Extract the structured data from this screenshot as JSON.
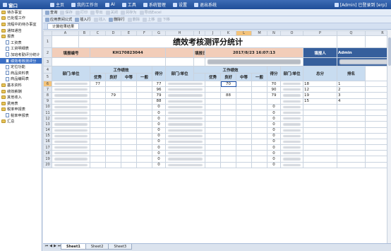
{
  "app": {
    "title": "窗口",
    "menu": [
      {
        "label": "主页"
      },
      {
        "label": "我的工作台"
      },
      {
        "label": "AI"
      },
      {
        "label": "工具"
      },
      {
        "label": "系统管理"
      },
      {
        "label": "设置"
      },
      {
        "label": "退出系统"
      }
    ],
    "user": "[Admin] 已登录到 [erp]"
  },
  "sidebar": {
    "items": [
      {
        "label": "待办事宜",
        "level": 1,
        "icon": "folder-icon"
      },
      {
        "label": "已处理工作",
        "level": 1,
        "icon": "folder-icon"
      },
      {
        "label": "流程中的待办事宜",
        "level": 1,
        "icon": "folder-icon"
      },
      {
        "label": "通知通告",
        "level": 1,
        "icon": "folder-icon"
      },
      {
        "label": "报表",
        "level": 1,
        "icon": "folder-icon"
      },
      {
        "label": "工资表",
        "level": 2,
        "icon": "doc-icon"
      },
      {
        "label": "工资明细表",
        "level": 2,
        "icon": "doc-icon"
      },
      {
        "label": "加班考勤评分统计",
        "level": 2,
        "icon": "doc-icon"
      },
      {
        "label": "绩效考核测评分",
        "level": 2,
        "icon": "doc-icon",
        "selected": true
      },
      {
        "label": "定位功能",
        "level": 2,
        "icon": "doc-icon"
      },
      {
        "label": "商品资料表",
        "level": 2,
        "icon": "doc-icon"
      },
      {
        "label": "商品编码表",
        "level": 2,
        "icon": "doc-icon"
      },
      {
        "label": "基本资料",
        "level": 1,
        "icon": "folder-icon"
      },
      {
        "label": "绩效薪酬",
        "level": 1,
        "icon": "folder-icon"
      },
      {
        "label": "其他收入",
        "level": 1,
        "icon": "folder-icon"
      },
      {
        "label": "费用表",
        "level": 1,
        "icon": "folder-icon"
      },
      {
        "label": "税率申报表",
        "level": 1,
        "icon": "folder-icon"
      },
      {
        "label": "税率申报表",
        "level": 2,
        "icon": "doc-icon"
      },
      {
        "label": "汇总",
        "level": 1,
        "icon": "folder-icon"
      }
    ]
  },
  "toolbar1": {
    "buttons": [
      {
        "label": "查询",
        "enabled": true
      },
      {
        "label": "保存",
        "enabled": false
      },
      {
        "label": "打印",
        "enabled": false
      },
      {
        "label": "导出",
        "enabled": false
      },
      {
        "label": "关闭",
        "enabled": false
      },
      {
        "label": "另存为",
        "enabled": false
      },
      {
        "label": "导出Excel",
        "enabled": false
      }
    ]
  },
  "toolbar2": {
    "buttons": [
      {
        "label": "应用表间公式",
        "enabled": true
      },
      {
        "label": "插入行",
        "enabled": true
      },
      {
        "label": "插入",
        "enabled": false
      },
      {
        "label": "删除行",
        "enabled": true
      },
      {
        "label": "删除",
        "enabled": false
      },
      {
        "label": "上移",
        "enabled": false
      },
      {
        "label": "下移",
        "enabled": false
      }
    ]
  },
  "tab": {
    "label": "计算结果结果"
  },
  "grid": {
    "columns": [
      "A",
      "B",
      "C",
      "D",
      "E",
      "F",
      "G",
      "H",
      "I",
      "J",
      "K",
      "L",
      "M",
      "N",
      "O",
      "P",
      "Q",
      "R"
    ],
    "selected_column": "L",
    "selected_row": "6",
    "title": "绩效考核测评分统计",
    "row2": {
      "review_no_label": "填报编号",
      "review_no": "KH170823044",
      "date_label": "填报日期",
      "date": "2017/8/23 16:07:13",
      "reviewer_label": "填报人",
      "reviewer": "Admin"
    },
    "header": {
      "dept": "部门/单位",
      "perf": "工作绩效",
      "score": "得分",
      "total": "总分",
      "rank": "排名",
      "levels": [
        "优秀",
        "良好",
        "中等",
        "一般"
      ]
    },
    "rows": [
      {
        "n": "6",
        "a1": "77",
        "a2": "",
        "a3": "",
        "s1": "77",
        "b1": "",
        "b2": "70",
        "b3": "",
        "s2": "70",
        "total": "18",
        "rank": "1"
      },
      {
        "n": "7",
        "a1": "",
        "a2": "",
        "a3": "",
        "s1": "96",
        "b1": "",
        "b2": "",
        "b3": "",
        "s2": "90",
        "total": "12",
        "rank": "2"
      },
      {
        "n": "8",
        "a1": "",
        "a2": "79",
        "a3": "",
        "s1": "79",
        "b1": "",
        "b2": "88",
        "b3": "",
        "s2": "79",
        "total": "19",
        "rank": "3"
      },
      {
        "n": "9",
        "a1": "",
        "a2": "",
        "a3": "",
        "s1": "88",
        "b1": "",
        "b2": "",
        "b3": "",
        "s2": "",
        "total": "15",
        "rank": "4"
      },
      {
        "n": "10",
        "s1": "0",
        "s2": "0"
      },
      {
        "n": "11",
        "s1": "0",
        "s2": "0"
      },
      {
        "n": "12",
        "s1": "0",
        "s2": "0"
      },
      {
        "n": "13",
        "s1": "0",
        "s2": "0"
      },
      {
        "n": "14",
        "s1": "0",
        "s2": "0"
      },
      {
        "n": "15",
        "s1": "0",
        "s2": "0"
      },
      {
        "n": "16",
        "s1": "0",
        "s2": "0"
      },
      {
        "n": "17",
        "s1": "0",
        "s2": "0"
      },
      {
        "n": "18",
        "s1": "0",
        "s2": "0"
      },
      {
        "n": "19",
        "s1": "0",
        "s2": "0"
      },
      {
        "n": "20",
        "s1": "0",
        "s2": "0"
      }
    ]
  },
  "sheets": [
    {
      "label": "Sheet1",
      "active": true
    },
    {
      "label": "Sheet2",
      "active": false
    },
    {
      "label": "Sheet3",
      "active": false
    }
  ]
}
